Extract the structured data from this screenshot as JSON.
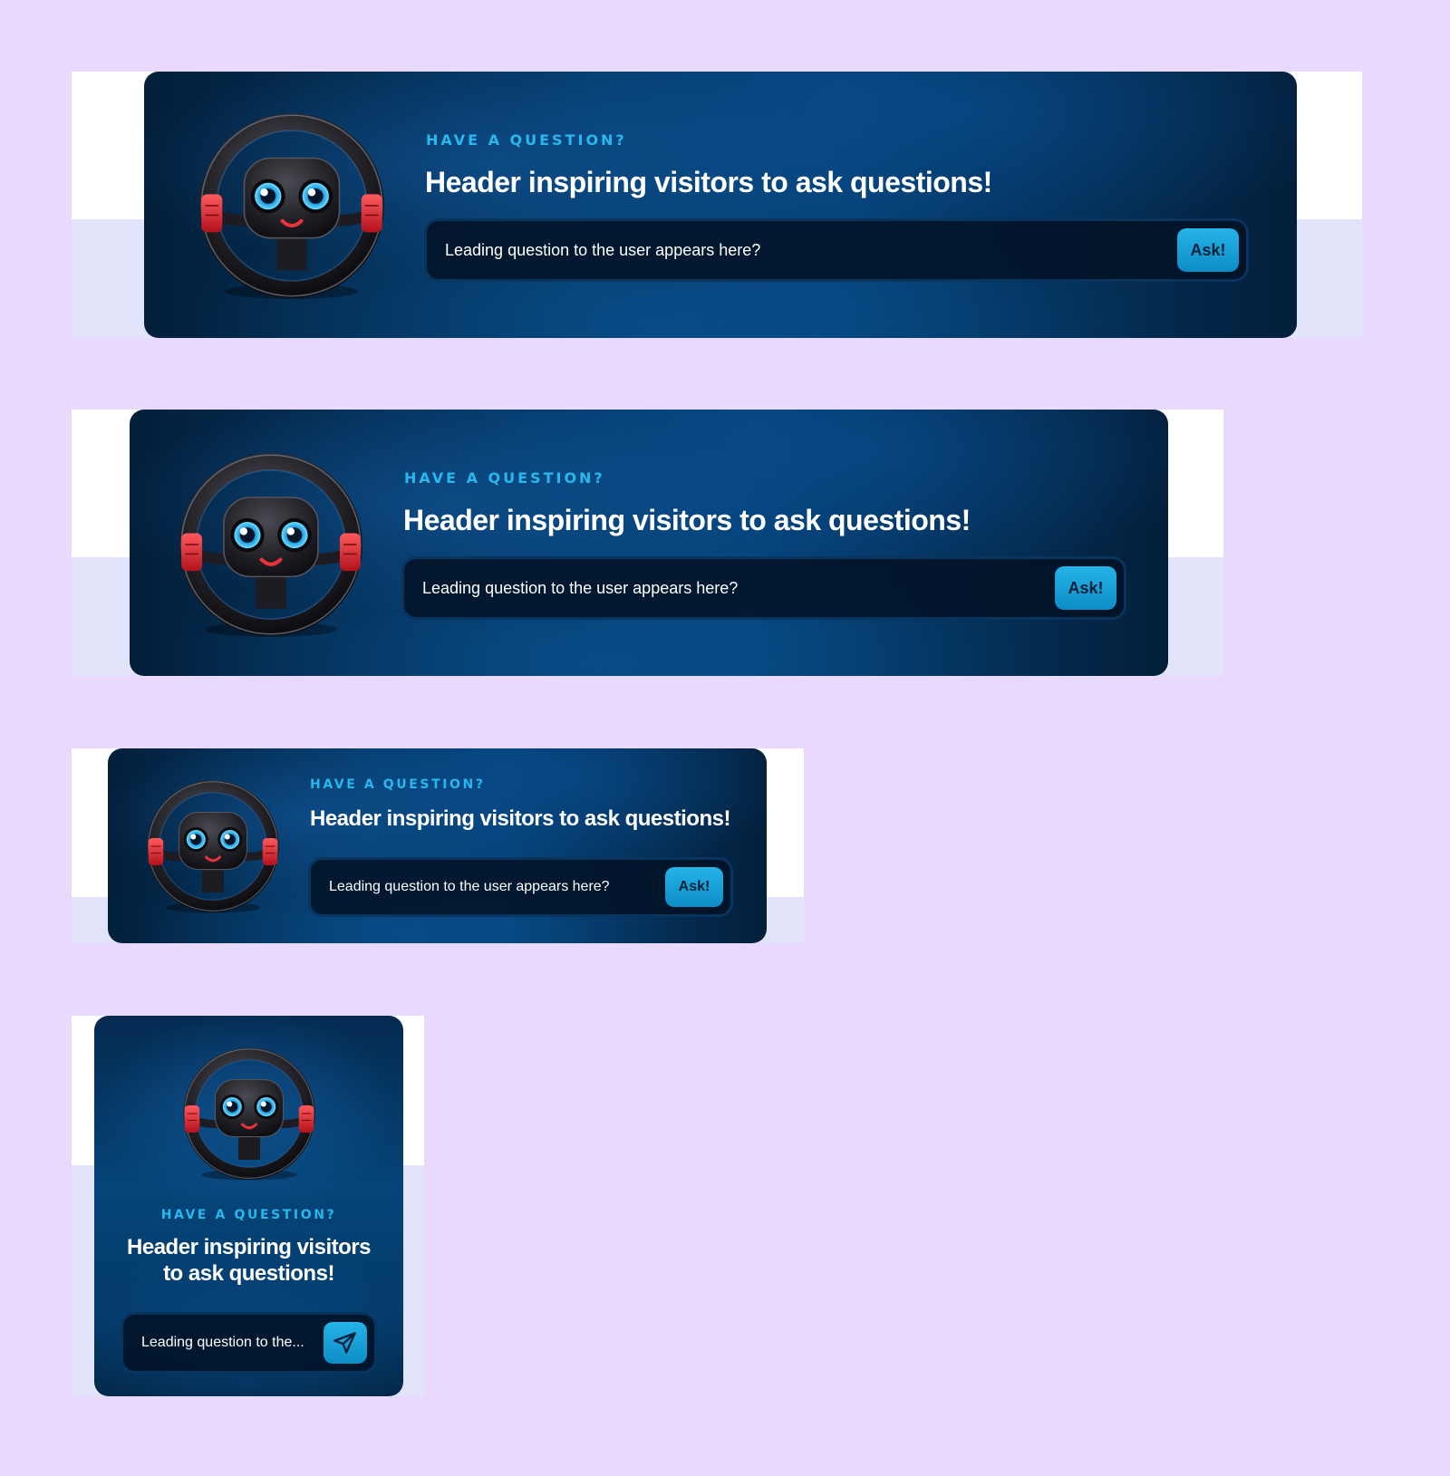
{
  "colors": {
    "page_background": "#e9d9fd",
    "card_navy": "#053e70",
    "accent_cyan": "#29b8ee",
    "button_blue": "#0d8cc6",
    "mascot_red": "#e8323c"
  },
  "widgets": [
    {
      "variant": "wide",
      "mascot_icon": "steering-wheel-mascot-icon",
      "eyebrow": "HAVE A QUESTION?",
      "headline": "Header inspiring visitors to ask questions!",
      "input_text": "Leading question to the user appears here?",
      "button_label": "Ask!"
    },
    {
      "variant": "medium",
      "mascot_icon": "steering-wheel-mascot-icon",
      "eyebrow": "HAVE A QUESTION?",
      "headline": "Header inspiring visitors to ask questions!",
      "input_text": "Leading question to the user appears here?",
      "button_label": "Ask!"
    },
    {
      "variant": "compact",
      "mascot_icon": "steering-wheel-mascot-icon",
      "eyebrow": "HAVE A QUESTION?",
      "headline": "Header inspiring visitors to ask questions!",
      "input_text": "Leading question to the user appears here?",
      "button_label": "Ask!"
    },
    {
      "variant": "mobile",
      "mascot_icon": "steering-wheel-mascot-icon",
      "eyebrow": "HAVE A QUESTION?",
      "headline_line1": "Header inspiring visitors",
      "headline_line2": "to ask questions!",
      "input_text": "Leading question to the...",
      "button_icon": "paper-plane-send-icon"
    }
  ]
}
